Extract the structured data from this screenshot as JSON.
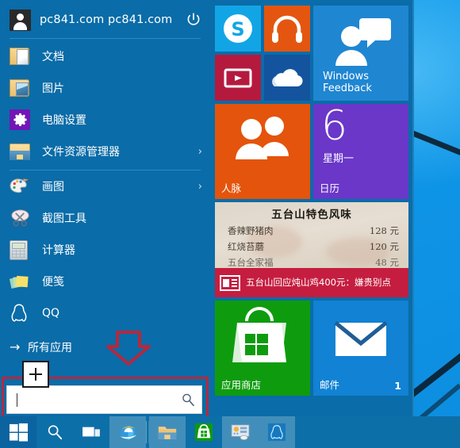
{
  "desktop": {
    "wallpaper_color": "#0e96e8",
    "streak_color": "#0c2030"
  },
  "start_menu": {
    "user": {
      "name": "pc841.com pc841.com",
      "avatar_icon": "user-avatar-icon",
      "power_icon": "power-icon"
    },
    "menu_items": [
      {
        "label": "文档",
        "icon": "documents-folder-icon",
        "chevron": ""
      },
      {
        "label": "图片",
        "icon": "pictures-folder-icon",
        "chevron": ""
      },
      {
        "label": "电脑设置",
        "icon": "settings-gear-icon",
        "chevron": ""
      },
      {
        "label": "文件资源管理器",
        "icon": "file-explorer-icon",
        "chevron": "›"
      },
      {
        "label": "画图",
        "icon": "paint-palette-icon",
        "chevron": "›"
      },
      {
        "label": "截图工具",
        "icon": "snipping-tool-icon",
        "chevron": ""
      },
      {
        "label": "计算器",
        "icon": "calculator-icon",
        "chevron": ""
      },
      {
        "label": "便笺",
        "icon": "sticky-notes-icon",
        "chevron": ""
      },
      {
        "label": "QQ",
        "icon": "qq-penguin-icon",
        "chevron": ""
      }
    ],
    "all_apps": {
      "label": "所有应用",
      "arrow": "→"
    },
    "search": {
      "value": "",
      "placeholder": "",
      "icon": "search-magnifier-icon"
    },
    "annotations": {
      "search_box_highlight_color": "#b3293f",
      "arrow_color": "#b3293f",
      "cursor": "crosshair-cursor"
    }
  },
  "tiles": {
    "skype": {
      "label": "",
      "icon": "skype-icon",
      "color": "#12a5e6"
    },
    "music": {
      "label": "",
      "icon": "headphones-music-icon",
      "color": "#e4560f"
    },
    "video": {
      "label": "",
      "icon": "video-play-icon",
      "color": "#b51a3e"
    },
    "onedrive": {
      "label": "",
      "icon": "onedrive-cloud-icon",
      "color": "#14549e"
    },
    "feedback": {
      "label": "Windows\nFeedback",
      "label_line1": "Windows",
      "label_line2": "Feedback",
      "icon": "feedback-person-chat-icon",
      "color": "#1f86d2"
    },
    "people": {
      "label": "人脉",
      "icon": "people-icon",
      "color": "#e4540c"
    },
    "calendar": {
      "label": "日历",
      "day": "6",
      "weekday": "星期一",
      "color": "#6a37c9"
    },
    "news": {
      "menu_title": "五台山特色风味",
      "menu_rows": [
        {
          "name": "香辣野猪肉",
          "price": "128 元"
        },
        {
          "name": "红烧苔蘑",
          "price": "120 元"
        },
        {
          "name": "五台全家福",
          "price": "48 元"
        }
      ],
      "headline": "五台山回应炖山鸡400元：嫌贵别点",
      "headline_icon": "news-article-icon",
      "bar_color": "#c51d3f"
    },
    "store": {
      "label": "应用商店",
      "icon": "windows-store-bag-icon",
      "color": "#0e9c0e"
    },
    "mail": {
      "label": "邮件",
      "badge": "1",
      "icon": "mail-envelope-icon",
      "color": "#1182d4"
    }
  },
  "taskbar": {
    "buttons": [
      {
        "name": "start",
        "icon": "windows-logo-icon",
        "active": false
      },
      {
        "name": "search",
        "icon": "search-magnifier-icon",
        "active": false
      },
      {
        "name": "task-view",
        "icon": "task-view-icon",
        "active": false
      },
      {
        "name": "internet-explorer",
        "icon": "internet-explorer-icon",
        "active": true
      },
      {
        "name": "file-explorer",
        "icon": "file-explorer-icon",
        "active": true
      },
      {
        "name": "store",
        "icon": "windows-store-bag-icon",
        "active": false
      },
      {
        "name": "control-panel",
        "icon": "control-panel-icon",
        "active": true
      },
      {
        "name": "qq",
        "icon": "qq-penguin-icon",
        "active": true
      }
    ]
  }
}
